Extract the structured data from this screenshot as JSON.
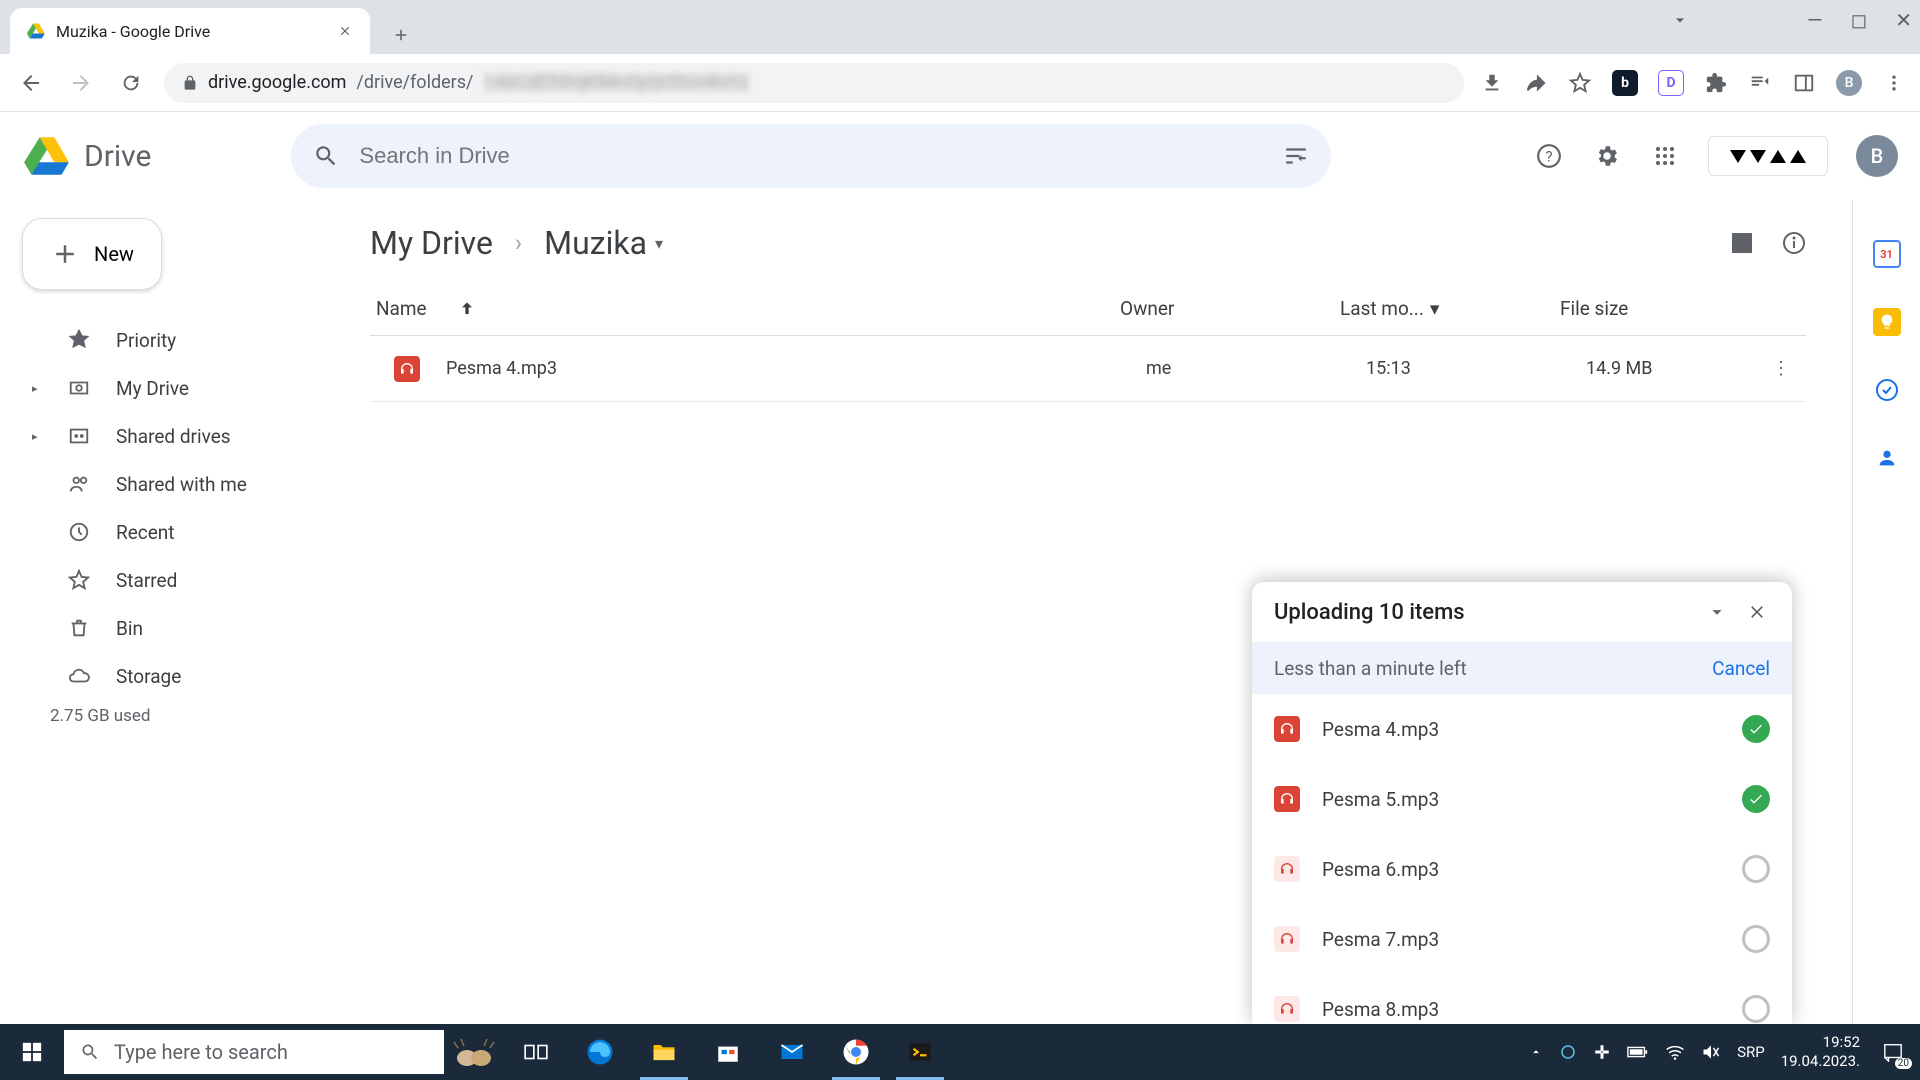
{
  "browser": {
    "tab_title": "Muzika - Google Drive",
    "url_domain": "drive.google.com",
    "url_path": "/drive/folders/",
    "url_obscured": "1AbCdEfGhIjKlMnOpQrStUvWxYz",
    "profile_letter": "B"
  },
  "drive": {
    "product_name": "Drive",
    "search_placeholder": "Search in Drive",
    "account_letter": "B",
    "new_button": "New",
    "nav": {
      "priority": "Priority",
      "mydrive": "My Drive",
      "shared_drives": "Shared drives",
      "shared_with_me": "Shared with me",
      "recent": "Recent",
      "starred": "Starred",
      "bin": "Bin",
      "storage": "Storage",
      "storage_used": "2.75 GB used"
    },
    "breadcrumb": {
      "root": "My Drive",
      "current": "Muzika"
    },
    "columns": {
      "name": "Name",
      "owner": "Owner",
      "modified": "Last mo...",
      "size": "File size"
    },
    "files": [
      {
        "name": "Pesma 4.mp3",
        "owner": "me",
        "modified": "15:13",
        "size": "14.9 MB"
      }
    ],
    "upload": {
      "title": "Uploading 10 items",
      "eta": "Less than a minute left",
      "cancel": "Cancel",
      "items": [
        {
          "name": "Pesma 4.mp3",
          "status": "done"
        },
        {
          "name": "Pesma 5.mp3",
          "status": "done"
        },
        {
          "name": "Pesma 6.mp3",
          "status": "pending"
        },
        {
          "name": "Pesma 7.mp3",
          "status": "pending"
        },
        {
          "name": "Pesma 8.mp3",
          "status": "pending"
        }
      ]
    }
  },
  "taskbar": {
    "search_placeholder": "Type here to search",
    "lang": "SRP",
    "time": "19:52",
    "date": "19.04.2023.",
    "notif_count": "20"
  }
}
